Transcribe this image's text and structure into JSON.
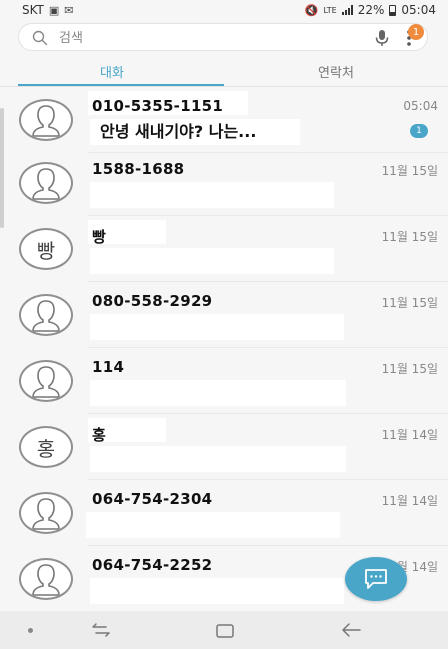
{
  "status_bar": {
    "carrier": "SKT",
    "network": "LTE",
    "battery": "22%",
    "time": "05:04"
  },
  "search": {
    "placeholder": "검색",
    "more_badge": "1"
  },
  "tabs": [
    {
      "label": "대화",
      "active": true
    },
    {
      "label": "연락처",
      "active": false
    }
  ],
  "conversations": [
    {
      "name": "010-5355-1151",
      "time": "05:04",
      "preview": "안녕 새내기야? 나는...",
      "unread": "1",
      "avatar": "person-icon"
    },
    {
      "name": "1588-1688",
      "time": "11월 15일",
      "preview": "",
      "avatar": "person-icon"
    },
    {
      "name": "빵",
      "time": "11월 15일",
      "preview": "",
      "avatar_text": "빵"
    },
    {
      "name": "080-558-2929",
      "time": "11월 15일",
      "preview": "",
      "avatar": "person-icon"
    },
    {
      "name": "114",
      "time": "11월 15일",
      "preview": "",
      "avatar": "person-icon"
    },
    {
      "name": "홍",
      "time": "11월 14일",
      "preview": "",
      "avatar_text": "홍"
    },
    {
      "name": "064-754-2304",
      "time": "11월 14일",
      "preview": "",
      "avatar": "person-icon"
    },
    {
      "name": "064-754-2252",
      "time": "11월 14일",
      "preview": "",
      "avatar": "person-icon"
    }
  ],
  "colors": {
    "accent": "#4aa6c8",
    "badge": "#f08a3c",
    "background": "#f6f6f6"
  }
}
